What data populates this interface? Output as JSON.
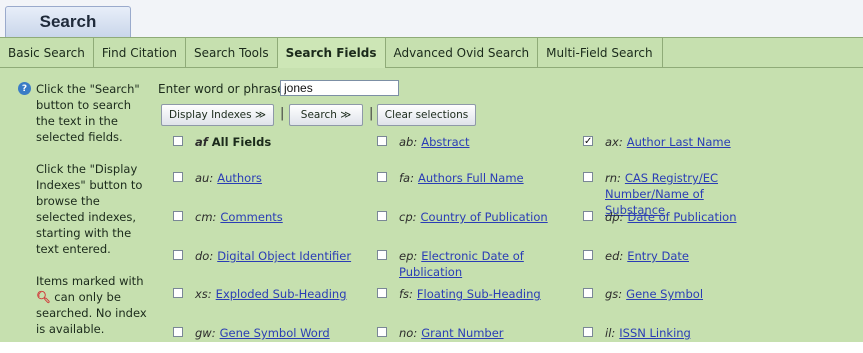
{
  "header": {
    "title": "Search"
  },
  "tabs": [
    {
      "label": "Basic Search"
    },
    {
      "label": "Find Citation"
    },
    {
      "label": "Search Tools"
    },
    {
      "label": "Search Fields",
      "active": true
    },
    {
      "label": "Advanced Ovid Search"
    },
    {
      "label": "Multi-Field Search"
    }
  ],
  "help": {
    "p1": "Click the \"Search\" button to search the text in the selected fields.",
    "p2": "Click the \"Display Indexes\" button to browse the selected indexes, starting with the text entered.",
    "p3_before": "Items marked with",
    "p3_after": "can only be searched. No index is available."
  },
  "entry": {
    "label": "Enter word or phrase:",
    "value": "jones"
  },
  "buttons": {
    "display_indexes": "Display Indexes ≫",
    "search": "Search ≫",
    "clear": "Clear selections",
    "sep": "|"
  },
  "fields": [
    {
      "code": "af",
      "label": "All Fields",
      "checked": false
    },
    {
      "code": "ab:",
      "label": "Abstract",
      "checked": false
    },
    {
      "code": "ax:",
      "label": "Author Last Name",
      "checked": true
    },
    {
      "code": "au:",
      "label": "Authors",
      "checked": false
    },
    {
      "code": "fa:",
      "label": "Authors Full Name",
      "checked": false
    },
    {
      "code": "rn:",
      "label": "CAS Registry/EC Number/Name of Substance",
      "checked": false
    },
    {
      "code": "cm:",
      "label": "Comments",
      "checked": false
    },
    {
      "code": "cp:",
      "label": "Country of Publication",
      "checked": false
    },
    {
      "code": "dp:",
      "label": "Date of Publication",
      "checked": false
    },
    {
      "code": "do:",
      "label": "Digital Object Identifier",
      "checked": false
    },
    {
      "code": "ep:",
      "label": "Electronic Date of Publication",
      "checked": false
    },
    {
      "code": "ed:",
      "label": "Entry Date",
      "checked": false
    },
    {
      "code": "xs:",
      "label": "Exploded Sub-Heading",
      "checked": false
    },
    {
      "code": "fs:",
      "label": "Floating Sub-Heading",
      "checked": false
    },
    {
      "code": "gs:",
      "label": "Gene Symbol",
      "checked": false
    },
    {
      "code": "gw:",
      "label": "Gene Symbol Word",
      "checked": false
    },
    {
      "code": "no:",
      "label": "Grant Number",
      "checked": false
    },
    {
      "code": "il:",
      "label": "ISSN Linking",
      "checked": false
    }
  ],
  "colors": {
    "panel": "#c6e0af",
    "link": "#2a3db5",
    "tab_border": "#8fab78"
  },
  "icons": {
    "help": "help-circle-icon",
    "search_marker": "magnifier-icon"
  }
}
